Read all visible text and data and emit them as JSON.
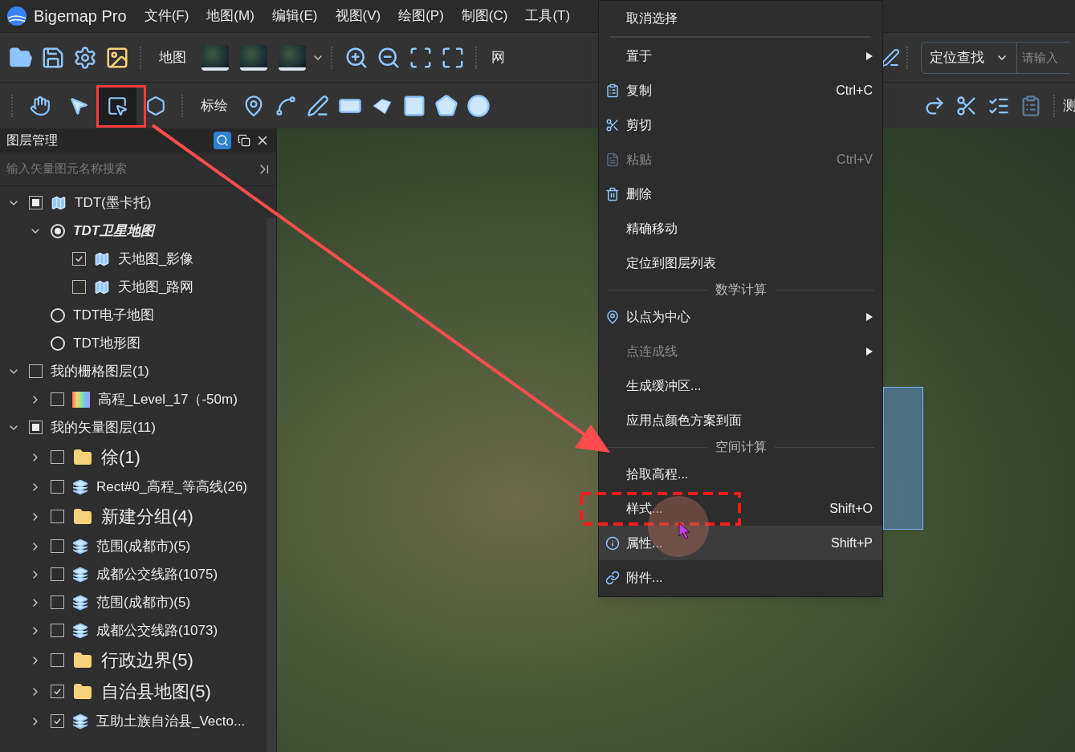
{
  "app": {
    "title": "Bigemap Pro"
  },
  "menu_bar": [
    "文件(F)",
    "地图(M)",
    "编辑(E)",
    "视图(V)",
    "绘图(P)",
    "制图(C)",
    "工具(T)"
  ],
  "toolbar_1": {
    "map_label": "地图",
    "grid_label": "网",
    "locate_dropdown": "定位查找",
    "search": {
      "placeholder": "请输入"
    }
  },
  "toolbar_2": {
    "tools": [
      {
        "kind": "hand",
        "selected": false
      },
      {
        "kind": "pointer",
        "selected": false
      },
      {
        "kind": "rect-select",
        "selected": true
      },
      {
        "kind": "poly-select",
        "selected": false
      }
    ],
    "plot_label": "标绘",
    "measure_label": "测"
  },
  "layer_panel": {
    "title": "图层管理",
    "search": {
      "placeholder": "输入矢量图元名称搜索"
    },
    "tree": [
      {
        "label": "TDT(墨卡托)",
        "kind": "map",
        "checked": false,
        "partial": true,
        "expanded": true,
        "children": [
          {
            "label": "TDT卫星地图",
            "kind": "radio",
            "checked": true,
            "expanded": true,
            "children": [
              {
                "label": "天地图_影像",
                "kind": "map",
                "checked": true,
                "partial": false
              },
              {
                "label": "天地图_路网",
                "kind": "map",
                "checked": false,
                "partial": false
              }
            ]
          },
          {
            "label": "TDT电子地图",
            "kind": "radio",
            "checked": false
          },
          {
            "label": "TDT地形图",
            "kind": "radio",
            "checked": false
          }
        ]
      },
      {
        "label": "我的栅格图层(1)",
        "kind": "group",
        "checked": false,
        "partial": false,
        "expanded": true,
        "children": [
          {
            "label": "高程_Level_17（-50m)",
            "kind": "gradient",
            "checked": false,
            "partial": false,
            "expanded": false
          }
        ]
      },
      {
        "label": "我的矢量图层(11)",
        "kind": "group",
        "checked": false,
        "partial": true,
        "expanded": true,
        "children": [
          {
            "label": "徐(1)",
            "kind": "folder",
            "checked": false,
            "partial": false,
            "expanded": false
          },
          {
            "label": "Rect#0_高程_等高线(26)",
            "kind": "layers",
            "checked": false,
            "partial": false,
            "expanded": false
          },
          {
            "label": "新建分组(4)",
            "kind": "folder",
            "checked": false,
            "partial": false,
            "expanded": false
          },
          {
            "label": "范围(成都市)(5)",
            "kind": "layers",
            "checked": false,
            "partial": false,
            "expanded": false
          },
          {
            "label": "成都公交线路(1075)",
            "kind": "layers",
            "checked": false,
            "partial": false,
            "expanded": false
          },
          {
            "label": "范围(成都市)(5)",
            "kind": "layers",
            "checked": false,
            "partial": false,
            "expanded": false
          },
          {
            "label": "成都公交线路(1073)",
            "kind": "layers",
            "checked": false,
            "partial": false,
            "expanded": false
          },
          {
            "label": "行政边界(5)",
            "kind": "folder",
            "checked": false,
            "partial": false,
            "expanded": false
          },
          {
            "label": "自治县地图(5)",
            "kind": "folder",
            "checked": true,
            "partial": false,
            "expanded": false
          },
          {
            "label": "互助土族自治县_Vecto...",
            "kind": "layers",
            "checked": true,
            "partial": false,
            "expanded": false
          }
        ]
      }
    ]
  },
  "context_menu": [
    {
      "kind": "item",
      "label": "取消选择",
      "selected": false,
      "disabled": false
    },
    {
      "kind": "separator"
    },
    {
      "kind": "item",
      "label": "置于",
      "submenu": true,
      "selected": false,
      "disabled": false
    },
    {
      "kind": "copy",
      "label": "复制",
      "shortcut": "Ctrl+C",
      "selected": false,
      "disabled": false
    },
    {
      "kind": "cut",
      "label": "剪切",
      "selected": false,
      "disabled": false
    },
    {
      "kind": "paste",
      "label": "粘贴",
      "shortcut": "Ctrl+V",
      "selected": false,
      "disabled": true
    },
    {
      "kind": "delete",
      "label": "删除",
      "selected": false,
      "disabled": false
    },
    {
      "kind": "item",
      "label": "精确移动",
      "selected": false,
      "disabled": false
    },
    {
      "kind": "item",
      "label": "定位到图层列表",
      "selected": false,
      "disabled": false
    },
    {
      "kind": "section",
      "label": "数学计算"
    },
    {
      "kind": "pin",
      "label": "以点为中心",
      "submenu": true,
      "selected": false,
      "disabled": false
    },
    {
      "kind": "item",
      "label": "点连成线",
      "submenu": true,
      "selected": false,
      "disabled": true
    },
    {
      "kind": "item",
      "label": "生成缓冲区...",
      "selected": false,
      "disabled": false
    },
    {
      "kind": "item",
      "label": "应用点颜色方案到面",
      "selected": false,
      "disabled": false
    },
    {
      "kind": "section",
      "label": "空间计算"
    },
    {
      "kind": "item",
      "label": "拾取高程...",
      "selected": false,
      "disabled": false
    },
    {
      "kind": "item",
      "label": "样式...",
      "shortcut": "Shift+O",
      "selected": false,
      "disabled": false
    },
    {
      "kind": "info",
      "label": "属性...",
      "shortcut": "Shift+P",
      "selected": true,
      "disabled": false
    },
    {
      "kind": "link",
      "label": "附件...",
      "selected": false,
      "disabled": false
    }
  ]
}
